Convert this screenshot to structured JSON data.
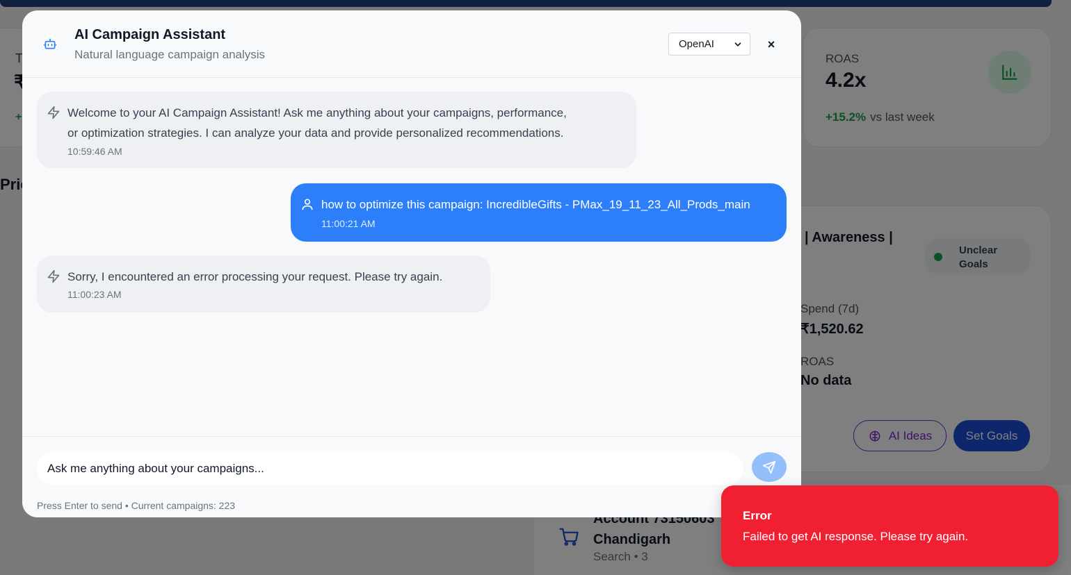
{
  "background": {
    "left_card": {
      "label_fragment": "T",
      "value_fragment": "₹",
      "change_fragment": "+"
    },
    "section_fragment": "Prio",
    "roas_card": {
      "label": "ROAS",
      "value": "4.2x",
      "change": "+15.2%",
      "change_suffix": "vs last week"
    },
    "campaign_card": {
      "name_fragment": "| Awareness |",
      "status": "Unclear Goals",
      "spend_label": "Spend (7d)",
      "spend_value": "₹1,520.62",
      "roas_label": "ROAS",
      "roas_value": "No data",
      "ai_ideas_label": "AI Ideas",
      "set_goals_label": "Set Goals"
    },
    "account_card": {
      "title_line1": "Account 73150603",
      "title_line2": "Chandigarh",
      "meta": "Search • 3"
    }
  },
  "modal": {
    "title": "AI Campaign Assistant",
    "subtitle": "Natural language campaign analysis",
    "provider": {
      "selected": "OpenAI"
    },
    "close_label": "×",
    "messages": [
      {
        "role": "assistant",
        "icon": "lightning-icon",
        "line1": "Welcome to your AI Campaign Assistant! Ask me anything about your campaigns, performance,",
        "line2": "or optimization strategies. I can analyze your data and provide personalized recommendations.",
        "time": "10:59:46 AM"
      },
      {
        "role": "user",
        "icon": "user-icon",
        "text": "how to optimize this campaign: IncredibleGifts - PMax_19_11_23_All_Prods_main",
        "time": "11:00:21 AM"
      },
      {
        "role": "assistant",
        "icon": "lightning-icon",
        "text": "Sorry, I encountered an error processing your request. Please try again.",
        "time": "11:00:23 AM"
      }
    ],
    "input": {
      "placeholder": "Ask me anything about your campaigns..."
    },
    "hint": "Press Enter to send • Current campaigns: 223"
  },
  "toast": {
    "title": "Error",
    "message": "Failed to get AI response. Please try again."
  },
  "colors": {
    "accent": "#2d7ff9",
    "error": "#f02032",
    "positive": "#16a34a",
    "purple": "#7e22ce",
    "brand_dark": "#22407f"
  }
}
